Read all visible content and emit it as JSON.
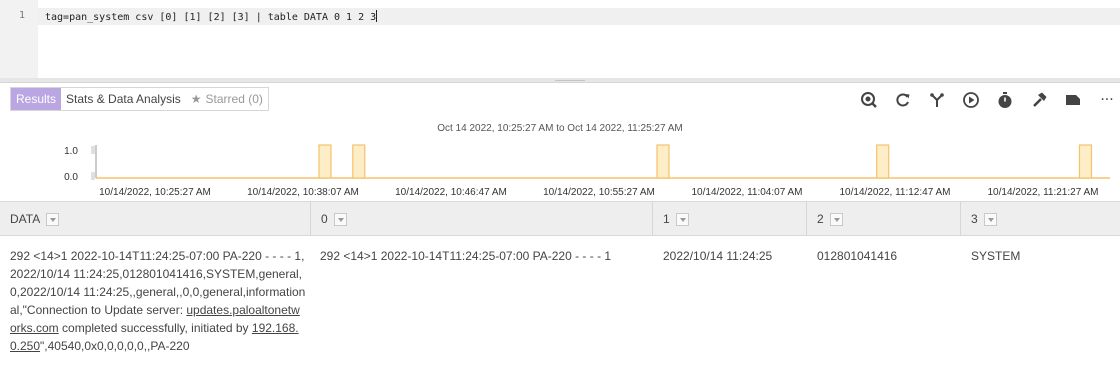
{
  "editor": {
    "line_number": "1",
    "query": "tag=pan_system csv [0] [1] [2] [3] | table DATA 0 1 2 3"
  },
  "tabs": {
    "results": "Results",
    "stats": "Stats & Data Analysis",
    "starred": "Starred (0)"
  },
  "toolbar": {
    "more_label": "···"
  },
  "chart_data": {
    "type": "bar",
    "title": "Oct 14 2022, 10:25:27 AM to Oct 14 2022, 11:25:27 AM",
    "y_ticks": [
      "1.0",
      "0.0"
    ],
    "ylim": [
      0,
      1
    ],
    "x_tick_labels": [
      "10/14/2022, 10:25:27 AM",
      "10/14/2022, 10:38:07 AM",
      "10/14/2022, 10:46:47 AM",
      "10/14/2022, 10:55:27 AM",
      "10/14/2022, 11:04:07 AM",
      "10/14/2022, 11:12:47 AM",
      "10/14/2022, 11:21:27 AM"
    ],
    "xlim": [
      "10:25:27",
      "11:25:27"
    ],
    "events": [
      {
        "time": "10:39",
        "value": 1
      },
      {
        "time": "10:41",
        "value": 1
      },
      {
        "time": "10:59",
        "value": 1
      },
      {
        "time": "11:12",
        "value": 1
      },
      {
        "time": "11:24",
        "value": 1
      }
    ],
    "bar_color": "#f5c26b"
  },
  "table": {
    "columns": [
      "DATA",
      "0",
      "1",
      "2",
      "3"
    ],
    "row": {
      "data_pre": "292 <14>1 2022-10-14T11:24:25-07:00 PA-220 - - - - 1,2022/10/14 11:24:25,012801041416,SYSTEM,general,0,2022/10/14 11:24:25,,general,,0,0,general,informational,\"Connection to Update server: ",
      "data_link1": "updates.paloaltonetworks.com",
      "data_mid": " completed successfully, initiated by ",
      "data_link2": "192.168.0.250",
      "data_post": "\",40540,0x0,0,0,0,0,,PA-220",
      "c0": "292 <14>1 2022-10-14T11:24:25-07:00 PA-220 - - - - 1",
      "c1": "2022/10/14 11:24:25",
      "c2": "012801041416",
      "c3": "SYSTEM"
    }
  }
}
